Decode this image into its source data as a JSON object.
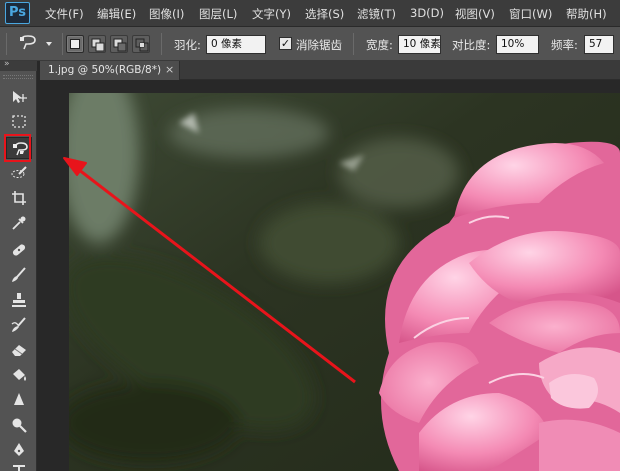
{
  "app": {
    "logo": "Ps"
  },
  "menu": [
    "文件(F)",
    "编辑(E)",
    "图像(I)",
    "图层(L)",
    "文字(Y)",
    "选择(S)",
    "滤镜(T)",
    "3D(D)",
    "视图(V)",
    "窗口(W)",
    "帮助(H)"
  ],
  "options": {
    "feather_label": "羽化:",
    "feather_value": "0 像素",
    "antialias_label": "消除锯齿",
    "antialias_checked": true,
    "width_label": "宽度:",
    "width_value": "10 像素",
    "contrast_label": "对比度:",
    "contrast_value": "10%",
    "frequency_label": "频率:",
    "frequency_value": "57"
  },
  "document": {
    "tab_title": "1.jpg @ 50%(RGB/8*)",
    "close_glyph": "×"
  },
  "toolbox": {
    "collapse_glyph": "»",
    "tools": [
      "move-tool",
      "marquee-tool",
      "magnetic-lasso-tool",
      "quick-selection-tool",
      "crop-tool",
      "eyedropper-tool",
      "spot-healing-tool",
      "brush-tool",
      "clone-stamp-tool",
      "history-brush-tool",
      "eraser-tool",
      "paint-bucket-tool",
      "blur-tool",
      "dodge-tool",
      "pen-tool"
    ],
    "selected": "magnetic-lasso-tool"
  },
  "colors": {
    "highlight": "#e8141b",
    "arrow": "#e8141b",
    "accent": "#4aa7e0",
    "flower": "#f07aa8"
  }
}
